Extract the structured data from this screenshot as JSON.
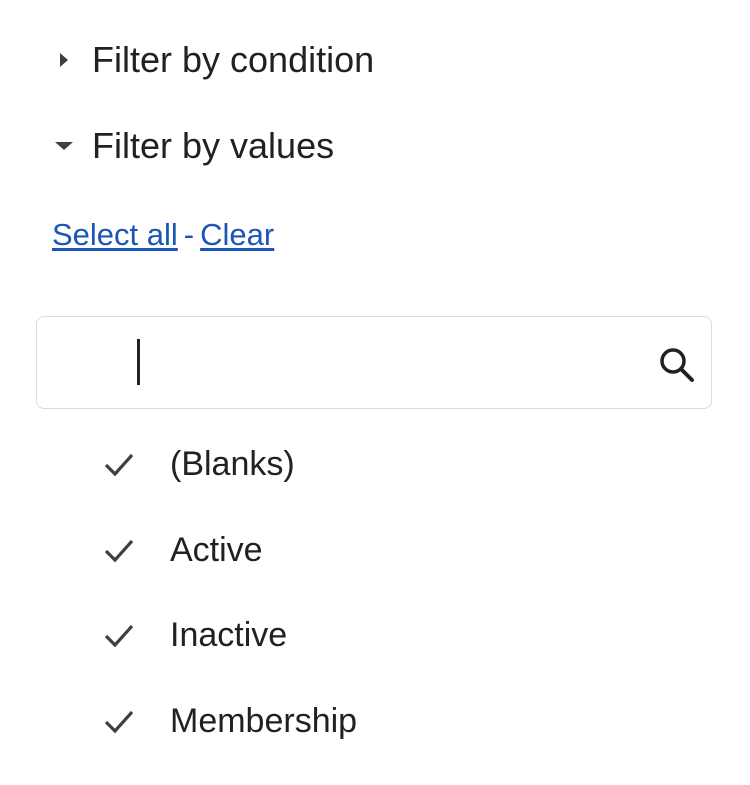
{
  "filter_by_condition": {
    "title": "Filter by condition",
    "expanded": false
  },
  "filter_by_values": {
    "title": "Filter by values",
    "expanded": true,
    "select_all_label": "Select all",
    "separator": "-",
    "clear_label": "Clear",
    "search": {
      "value": "",
      "icon": "search-icon"
    },
    "items": [
      {
        "label": "(Blanks)",
        "checked": true
      },
      {
        "label": "Active",
        "checked": true
      },
      {
        "label": "Inactive",
        "checked": true
      },
      {
        "label": "Membership",
        "checked": true
      }
    ]
  },
  "colors": {
    "text": "#202124",
    "link": "#1a55b8",
    "border": "#dadce0",
    "icon": "#3c4043"
  }
}
